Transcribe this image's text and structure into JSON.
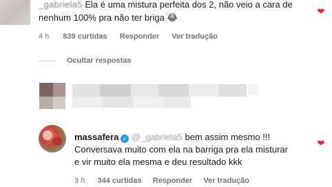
{
  "top_comment": {
    "username": "_gabriela5",
    "text_line1": "Ela é uma mistura perfeita dos 2, não veio a cara de",
    "text_line2": "nenhum 100% pra não ter briga 😂",
    "time": "4 h",
    "likes": "839 curtidas",
    "reply_label": "Responder",
    "translate_label": "Ver tradução"
  },
  "hide_replies_label": "Ocultar respostas",
  "reply_comment": {
    "username": "massafera",
    "mention": "@_gabriela5",
    "text_line1": "bem assim mesmo !!!",
    "text_line2": "Conversava muito com ela na barriga pra ela misturar",
    "text_line3": "e vir muito ela mesma e deu resultado kkk",
    "time": "3 h",
    "likes": "344 curtidas",
    "reply_label": "Responder",
    "translate_label": "Ver tradução"
  },
  "colors": {
    "heart": "#ed1c3a",
    "verified": "#1d9bf0",
    "meta_text": "#737373"
  },
  "icons": {
    "like": "heart-icon",
    "verified": "verified-badge-icon"
  }
}
